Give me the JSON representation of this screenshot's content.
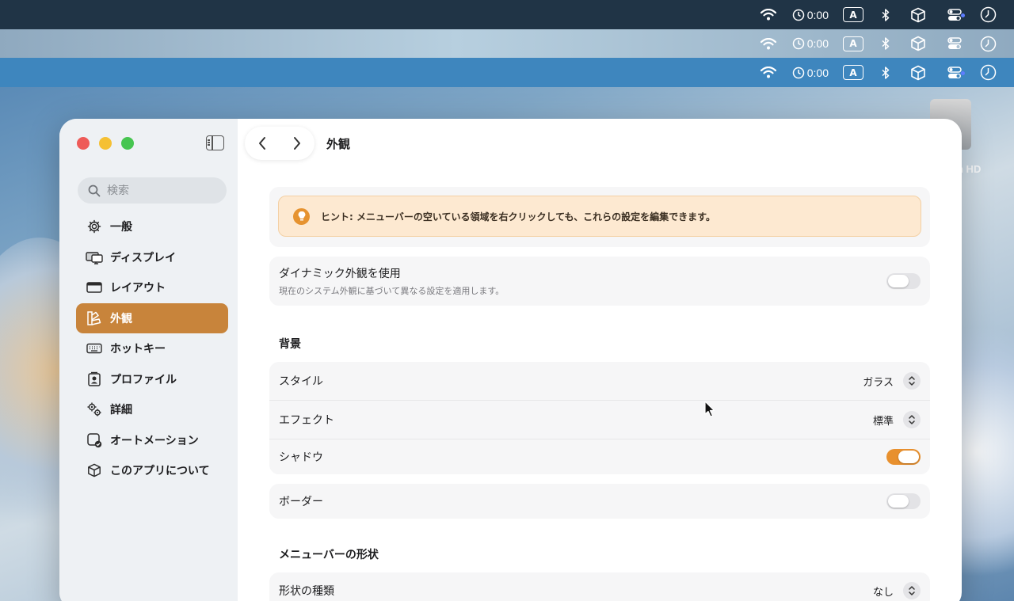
{
  "menubar": {
    "timer_text": "0:00",
    "input_source": "A",
    "icons": [
      "wifi-icon",
      "timer-icon",
      "input-source-icon",
      "bluetooth-icon",
      "cube-icon",
      "control-center-icon",
      "clock-icon"
    ]
  },
  "desktop": {
    "disk_label": "h HD"
  },
  "window": {
    "title": "外観",
    "search": {
      "placeholder": "検索",
      "value": ""
    },
    "sidebar": {
      "items": [
        {
          "label": "一般",
          "icon": "gear-icon",
          "active": false
        },
        {
          "label": "ディスプレイ",
          "icon": "displays-icon",
          "active": false
        },
        {
          "label": "レイアウト",
          "icon": "layout-icon",
          "active": false
        },
        {
          "label": "外観",
          "icon": "appearance-icon",
          "active": true
        },
        {
          "label": "ホットキー",
          "icon": "keyboard-icon",
          "active": false
        },
        {
          "label": "プロファイル",
          "icon": "profile-icon",
          "active": false
        },
        {
          "label": "詳細",
          "icon": "gears-icon",
          "active": false
        },
        {
          "label": "オートメーション",
          "icon": "automation-icon",
          "active": false
        },
        {
          "label": "このアプリについて",
          "icon": "cube-icon",
          "active": false
        }
      ]
    },
    "hint": "ヒント: メニューバーの空いている領域を右クリックしても、これらの設定を編集できます。",
    "dynamic": {
      "label": "ダイナミック外観を使用",
      "description": "現在のシステム外観に基づいて異なる設定を適用します。",
      "enabled": false
    },
    "background": {
      "section_title": "背景",
      "style": {
        "label": "スタイル",
        "value": "ガラス"
      },
      "effect": {
        "label": "エフェクト",
        "value": "標準"
      },
      "shadow": {
        "label": "シャドウ",
        "enabled": true
      },
      "border": {
        "label": "ボーダー",
        "enabled": false
      }
    },
    "shape": {
      "section_title": "メニューバーの形状",
      "type": {
        "label": "形状の種類",
        "value": "なし"
      }
    }
  },
  "colors": {
    "accent": "#c8843b",
    "toggle_on": "#e8902e",
    "hint_background": "#fde9d1"
  }
}
